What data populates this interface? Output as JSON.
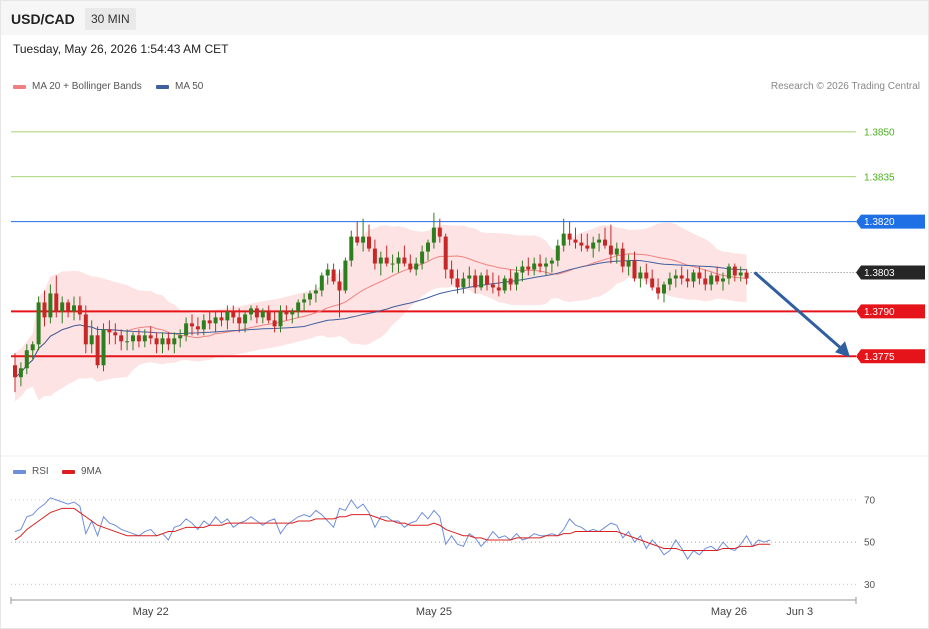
{
  "header": {
    "symbol": "USD/CAD",
    "timeframe": "30 MIN",
    "datetime": "Tuesday, May 26, 2026 1:54:43 AM CET"
  },
  "legend": {
    "ma20_label": "MA 20 + Bollinger Bands",
    "ma50_label": "MA 50",
    "credit": "Research © 2026 Trading Central"
  },
  "rsi_legend": {
    "rsi_label": "RSI",
    "ma9_label": "9MA"
  },
  "colors": {
    "bull": "#2e7d1e",
    "bear": "#c62828",
    "ma20": "#f08080",
    "ma50": "#3f5f9e",
    "bollinger_fill": "#fde3e3",
    "resistance_green": "#8bc34a",
    "level_blue": "#1f6fe5",
    "level_red": "#e5141b",
    "rsi_line": "#6f8fdc",
    "rsi_ma": "#d92020"
  },
  "chart_data": {
    "type": "candlestick",
    "price_ylim": [
      1.3742,
      1.3862
    ],
    "levels": [
      {
        "label": "1.3850",
        "value": 1.385,
        "kind": "resistance-green",
        "tag": "text"
      },
      {
        "label": "1.3835",
        "value": 1.3835,
        "kind": "resistance-green",
        "tag": "text"
      },
      {
        "label": "1.3820",
        "value": 1.382,
        "kind": "blue",
        "tag": "box"
      },
      {
        "label": "1.3803",
        "value": 1.3803,
        "kind": "last",
        "tag": "box"
      },
      {
        "label": "1.3790",
        "value": 1.379,
        "kind": "support-red",
        "tag": "box"
      },
      {
        "label": "1.3775",
        "value": 1.3775,
        "kind": "support-red",
        "tag": "box"
      }
    ],
    "arrow": {
      "from": 1.3803,
      "to": 1.3775,
      "direction": "down"
    },
    "x_ticks": [
      "May 22",
      "May 25",
      "May 26",
      "Jun 3"
    ],
    "x_tick_candle_index": [
      23,
      71,
      121,
      133
    ],
    "candles": [
      [
        1.3772,
        1.3776,
        1.3763,
        1.3768
      ],
      [
        1.3768,
        1.3773,
        1.3765,
        1.3771
      ],
      [
        1.3771,
        1.3779,
        1.3769,
        1.3777
      ],
      [
        1.3777,
        1.378,
        1.3774,
        1.3779
      ],
      [
        1.3779,
        1.3795,
        1.3777,
        1.3793
      ],
      [
        1.3793,
        1.3797,
        1.3785,
        1.3788
      ],
      [
        1.3788,
        1.3799,
        1.3786,
        1.3796
      ],
      [
        1.3796,
        1.3802,
        1.3788,
        1.379
      ],
      [
        1.379,
        1.3795,
        1.3786,
        1.3793
      ],
      [
        1.3793,
        1.3794,
        1.3788,
        1.379
      ],
      [
        1.379,
        1.3795,
        1.3787,
        1.3792
      ],
      [
        1.3792,
        1.3795,
        1.3787,
        1.3789
      ],
      [
        1.3789,
        1.3792,
        1.3776,
        1.3779
      ],
      [
        1.3779,
        1.3787,
        1.3776,
        1.3782
      ],
      [
        1.3782,
        1.3785,
        1.3771,
        1.3772
      ],
      [
        1.3772,
        1.3786,
        1.377,
        1.3784
      ],
      [
        1.3784,
        1.3787,
        1.3779,
        1.3783
      ],
      [
        1.3783,
        1.3786,
        1.3779,
        1.3782
      ],
      [
        1.3782,
        1.3784,
        1.3777,
        1.378
      ],
      [
        1.378,
        1.3784,
        1.3777,
        1.378
      ],
      [
        1.378,
        1.3783,
        1.3777,
        1.3782
      ],
      [
        1.3782,
        1.3784,
        1.3778,
        1.378
      ],
      [
        1.378,
        1.3784,
        1.3778,
        1.3782
      ],
      [
        1.3782,
        1.3785,
        1.3779,
        1.3781
      ],
      [
        1.3781,
        1.3783,
        1.3776,
        1.3779
      ],
      [
        1.3779,
        1.3783,
        1.3776,
        1.3781
      ],
      [
        1.3781,
        1.3783,
        1.3777,
        1.3779
      ],
      [
        1.3779,
        1.3783,
        1.3776,
        1.3781
      ],
      [
        1.3781,
        1.3784,
        1.3778,
        1.3782
      ],
      [
        1.3782,
        1.3788,
        1.378,
        1.3786
      ],
      [
        1.3786,
        1.3789,
        1.3782,
        1.3785
      ],
      [
        1.3785,
        1.3788,
        1.3782,
        1.3784
      ],
      [
        1.3784,
        1.3789,
        1.3782,
        1.3787
      ],
      [
        1.3787,
        1.379,
        1.3784,
        1.3786
      ],
      [
        1.3786,
        1.379,
        1.3783,
        1.3788
      ],
      [
        1.3788,
        1.379,
        1.3785,
        1.3787
      ],
      [
        1.3787,
        1.3792,
        1.3784,
        1.379
      ],
      [
        1.379,
        1.3792,
        1.3786,
        1.3788
      ],
      [
        1.3788,
        1.3791,
        1.3783,
        1.3786
      ],
      [
        1.3786,
        1.379,
        1.3783,
        1.3789
      ],
      [
        1.3789,
        1.3792,
        1.3787,
        1.3791
      ],
      [
        1.3791,
        1.3792,
        1.3786,
        1.3788
      ],
      [
        1.3788,
        1.3791,
        1.3786,
        1.379
      ],
      [
        1.379,
        1.3792,
        1.3786,
        1.3787
      ],
      [
        1.3787,
        1.379,
        1.3783,
        1.3785
      ],
      [
        1.3785,
        1.3792,
        1.3783,
        1.379
      ],
      [
        1.379,
        1.3792,
        1.3787,
        1.3789
      ],
      [
        1.3789,
        1.3791,
        1.3786,
        1.379
      ],
      [
        1.379,
        1.3794,
        1.3788,
        1.3793
      ],
      [
        1.3793,
        1.3796,
        1.379,
        1.3794
      ],
      [
        1.3794,
        1.3797,
        1.3792,
        1.3796
      ],
      [
        1.3796,
        1.3799,
        1.3793,
        1.3797
      ],
      [
        1.3797,
        1.3803,
        1.3795,
        1.3802
      ],
      [
        1.3802,
        1.3806,
        1.3799,
        1.3804
      ],
      [
        1.3804,
        1.3806,
        1.3799,
        1.38
      ],
      [
        1.38,
        1.3804,
        1.3788,
        1.3797
      ],
      [
        1.3797,
        1.3808,
        1.3796,
        1.3807
      ],
      [
        1.3807,
        1.3817,
        1.3805,
        1.3815
      ],
      [
        1.3815,
        1.382,
        1.3812,
        1.3813
      ],
      [
        1.3813,
        1.3821,
        1.381,
        1.3815
      ],
      [
        1.3815,
        1.3819,
        1.381,
        1.3811
      ],
      [
        1.3811,
        1.3814,
        1.3804,
        1.3806
      ],
      [
        1.3806,
        1.381,
        1.3802,
        1.3808
      ],
      [
        1.3808,
        1.3812,
        1.3805,
        1.3806
      ],
      [
        1.3806,
        1.3809,
        1.3803,
        1.3806
      ],
      [
        1.3806,
        1.381,
        1.3803,
        1.3808
      ],
      [
        1.3808,
        1.3812,
        1.3805,
        1.3806
      ],
      [
        1.3806,
        1.3809,
        1.3803,
        1.3804
      ],
      [
        1.3804,
        1.3808,
        1.3802,
        1.3806
      ],
      [
        1.3806,
        1.3812,
        1.3804,
        1.381
      ],
      [
        1.381,
        1.3814,
        1.3807,
        1.3813
      ],
      [
        1.3813,
        1.3823,
        1.3811,
        1.3818
      ],
      [
        1.3818,
        1.3821,
        1.3813,
        1.3815
      ],
      [
        1.3815,
        1.3816,
        1.3801,
        1.3804
      ],
      [
        1.3804,
        1.3807,
        1.3799,
        1.3801
      ],
      [
        1.3801,
        1.3804,
        1.3796,
        1.3798
      ],
      [
        1.3798,
        1.3803,
        1.3796,
        1.3801
      ],
      [
        1.3801,
        1.3805,
        1.3798,
        1.3802
      ],
      [
        1.3802,
        1.3804,
        1.3796,
        1.3798
      ],
      [
        1.3798,
        1.3803,
        1.3797,
        1.3802
      ],
      [
        1.3802,
        1.3804,
        1.3797,
        1.3799
      ],
      [
        1.3799,
        1.3803,
        1.3796,
        1.3798
      ],
      [
        1.3798,
        1.3802,
        1.3795,
        1.3797
      ],
      [
        1.3797,
        1.3802,
        1.3796,
        1.3801
      ],
      [
        1.3801,
        1.3804,
        1.3797,
        1.3799
      ],
      [
        1.3799,
        1.3805,
        1.3797,
        1.3803
      ],
      [
        1.3803,
        1.3807,
        1.38,
        1.3805
      ],
      [
        1.3805,
        1.3808,
        1.3802,
        1.3804
      ],
      [
        1.3804,
        1.3808,
        1.3802,
        1.3806
      ],
      [
        1.3806,
        1.3809,
        1.3803,
        1.3805
      ],
      [
        1.3805,
        1.3808,
        1.3802,
        1.3806
      ],
      [
        1.3806,
        1.3808,
        1.3803,
        1.3807
      ],
      [
        1.3807,
        1.3814,
        1.3805,
        1.3812
      ],
      [
        1.3812,
        1.3821,
        1.381,
        1.3816
      ],
      [
        1.3816,
        1.382,
        1.3812,
        1.3814
      ],
      [
        1.3814,
        1.3818,
        1.3811,
        1.3813
      ],
      [
        1.3813,
        1.3816,
        1.381,
        1.3812
      ],
      [
        1.3812,
        1.3816,
        1.381,
        1.3811
      ],
      [
        1.3811,
        1.3815,
        1.3808,
        1.3813
      ],
      [
        1.3813,
        1.3816,
        1.381,
        1.3814
      ],
      [
        1.3814,
        1.3818,
        1.3811,
        1.3812
      ],
      [
        1.3812,
        1.3819,
        1.3806,
        1.3809
      ],
      [
        1.3809,
        1.3813,
        1.3806,
        1.3811
      ],
      [
        1.3811,
        1.3813,
        1.3803,
        1.3805
      ],
      [
        1.3805,
        1.3809,
        1.3802,
        1.3807
      ],
      [
        1.3807,
        1.381,
        1.38,
        1.3801
      ],
      [
        1.3801,
        1.3805,
        1.3798,
        1.3803
      ],
      [
        1.3803,
        1.3806,
        1.3799,
        1.3801
      ],
      [
        1.3801,
        1.3804,
        1.3797,
        1.3798
      ],
      [
        1.3798,
        1.3801,
        1.3794,
        1.3796
      ],
      [
        1.3796,
        1.38,
        1.3793,
        1.3799
      ],
      [
        1.3799,
        1.3803,
        1.3797,
        1.3801
      ],
      [
        1.3801,
        1.3804,
        1.3798,
        1.3802
      ],
      [
        1.3802,
        1.3805,
        1.3799,
        1.3801
      ],
      [
        1.3801,
        1.3804,
        1.3798,
        1.38
      ],
      [
        1.38,
        1.3804,
        1.3798,
        1.3803
      ],
      [
        1.3803,
        1.3805,
        1.3799,
        1.3801
      ],
      [
        1.3801,
        1.3804,
        1.3797,
        1.3799
      ],
      [
        1.3799,
        1.3803,
        1.3797,
        1.3802
      ],
      [
        1.3802,
        1.3805,
        1.3799,
        1.38
      ],
      [
        1.38,
        1.3803,
        1.3797,
        1.3801
      ],
      [
        1.3801,
        1.3806,
        1.3799,
        1.3805
      ],
      [
        1.3805,
        1.3806,
        1.38,
        1.3802
      ],
      [
        1.3802,
        1.3805,
        1.38,
        1.3803
      ],
      [
        1.3803,
        1.3804,
        1.3799,
        1.3801
      ]
    ],
    "rsi": {
      "ylim": [
        24,
        78
      ],
      "levels": [
        30,
        50,
        70
      ],
      "values": [
        55,
        56,
        62,
        63,
        66,
        68,
        71,
        70,
        69,
        68,
        69,
        67,
        54,
        60,
        53,
        62,
        59,
        58,
        56,
        55,
        54,
        53,
        55,
        56,
        53,
        54,
        51,
        57,
        58,
        61,
        59,
        56,
        60,
        58,
        62,
        59,
        61,
        57,
        59,
        60,
        62,
        60,
        58,
        60,
        61,
        54,
        58,
        60,
        62,
        63,
        62,
        65,
        63,
        60,
        57,
        66,
        65,
        70,
        66,
        68,
        64,
        57,
        62,
        62,
        60,
        60,
        57,
        59,
        60,
        64,
        61,
        65,
        62,
        49,
        53,
        49,
        48,
        54,
        52,
        48,
        51,
        55,
        52,
        53,
        51,
        54,
        51,
        52,
        54,
        53,
        53,
        54,
        53,
        56,
        61,
        58,
        57,
        55,
        56,
        55,
        57,
        59,
        58,
        52,
        55,
        50,
        53,
        47,
        51,
        48,
        44,
        46,
        51,
        47,
        42,
        46,
        44,
        47,
        48,
        46,
        50,
        47,
        46,
        49,
        53,
        48,
        51,
        50,
        51
      ],
      "ma9": [
        51,
        53,
        56,
        58,
        60,
        62,
        64,
        65,
        66,
        66,
        66,
        64,
        62,
        60,
        58,
        57,
        56,
        55,
        54,
        53,
        53,
        53,
        53,
        53,
        53,
        54,
        55,
        55,
        56,
        57,
        57,
        57,
        57,
        58,
        58,
        58,
        59,
        59,
        59,
        59,
        59,
        59,
        59,
        59,
        59,
        59,
        59,
        59,
        60,
        60,
        60,
        61,
        61,
        61,
        61,
        62,
        62,
        63,
        63,
        63,
        63,
        62,
        61,
        60,
        60,
        59,
        59,
        58,
        58,
        58,
        58,
        59,
        58,
        56,
        55,
        54,
        53,
        53,
        52,
        52,
        51,
        51,
        51,
        51,
        51,
        52,
        52,
        52,
        52,
        52,
        53,
        53,
        53,
        54,
        54,
        55,
        55,
        55,
        55,
        55,
        55,
        55,
        55,
        54,
        53,
        52,
        51,
        50,
        49,
        48,
        47,
        47,
        47,
        46,
        46,
        46,
        46,
        46,
        46,
        46,
        47,
        47,
        47,
        48,
        48,
        48,
        49,
        49,
        49
      ]
    }
  }
}
